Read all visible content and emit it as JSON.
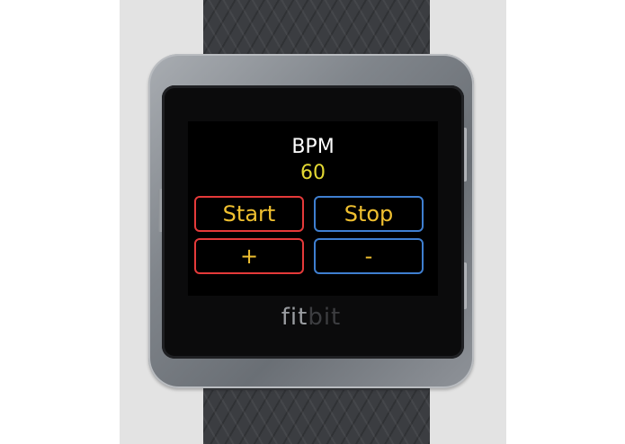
{
  "screen": {
    "label": "BPM",
    "value": "60",
    "buttons": {
      "start": "Start",
      "stop": "Stop",
      "plus": "+",
      "minus": "-"
    }
  },
  "branding": {
    "part1": "fit",
    "part2": "bit"
  },
  "colors": {
    "start_border": "#e53a3a",
    "stop_border": "#3f7fd0",
    "button_text": "#f0c030",
    "value_text": "#e3d833"
  }
}
